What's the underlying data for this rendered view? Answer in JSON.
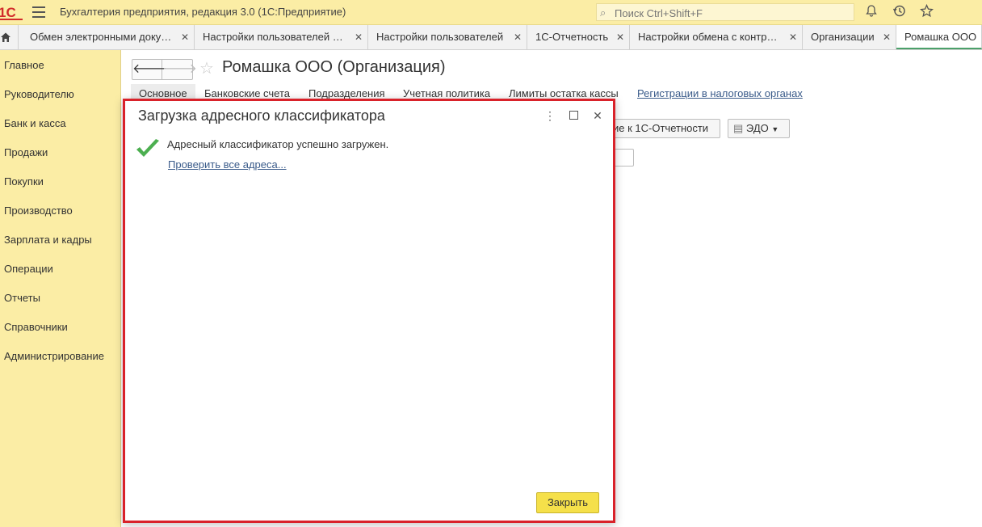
{
  "titlebar": {
    "logo_text": "1С",
    "app_title": "Бухгалтерия предприятия, редакция 3.0  (1С:Предприятие)",
    "search_placeholder": "Поиск Ctrl+Shift+F"
  },
  "tabs": [
    {
      "label": "Обмен электронными доку…"
    },
    {
      "label": "Настройки пользователей …"
    },
    {
      "label": "Настройки пользователей"
    },
    {
      "label": "1С-Отчетность"
    },
    {
      "label": "Настройки обмена с контр…"
    },
    {
      "label": "Организации"
    },
    {
      "label": "Ромашка ООО"
    }
  ],
  "sidebar": {
    "items": [
      {
        "label": "Главное"
      },
      {
        "label": "Руководителю"
      },
      {
        "label": "Банк и касса"
      },
      {
        "label": "Продажи"
      },
      {
        "label": "Покупки"
      },
      {
        "label": "Производство"
      },
      {
        "label": "Зарплата и кадры"
      },
      {
        "label": "Операции"
      },
      {
        "label": "Отчеты"
      },
      {
        "label": "Справочники"
      },
      {
        "label": "Администрирование"
      }
    ]
  },
  "form": {
    "title": "Ромашка ООО (Организация)",
    "tabs": [
      {
        "label": "Основное"
      },
      {
        "label": "Банковские счета"
      },
      {
        "label": "Подразделения"
      },
      {
        "label": "Учетная политика"
      },
      {
        "label": "Лимиты остатка кассы"
      },
      {
        "label": "Регистрации в налоговых органах"
      }
    ],
    "connect_button": "ие к 1С-Отчетности",
    "edo_button": "ЭДО"
  },
  "dialog": {
    "title": "Загрузка адресного классификатора",
    "message": "Адресный классификатор успешно загружен.",
    "link": "Проверить все адреса...",
    "close_button": "Закрыть"
  },
  "colors": {
    "panel_yellow": "#fbeda5",
    "highlight_red": "#d9222a",
    "button_yellow": "#f5e04a",
    "check_green": "#4caf50",
    "logo_red": "#d22b2b"
  }
}
